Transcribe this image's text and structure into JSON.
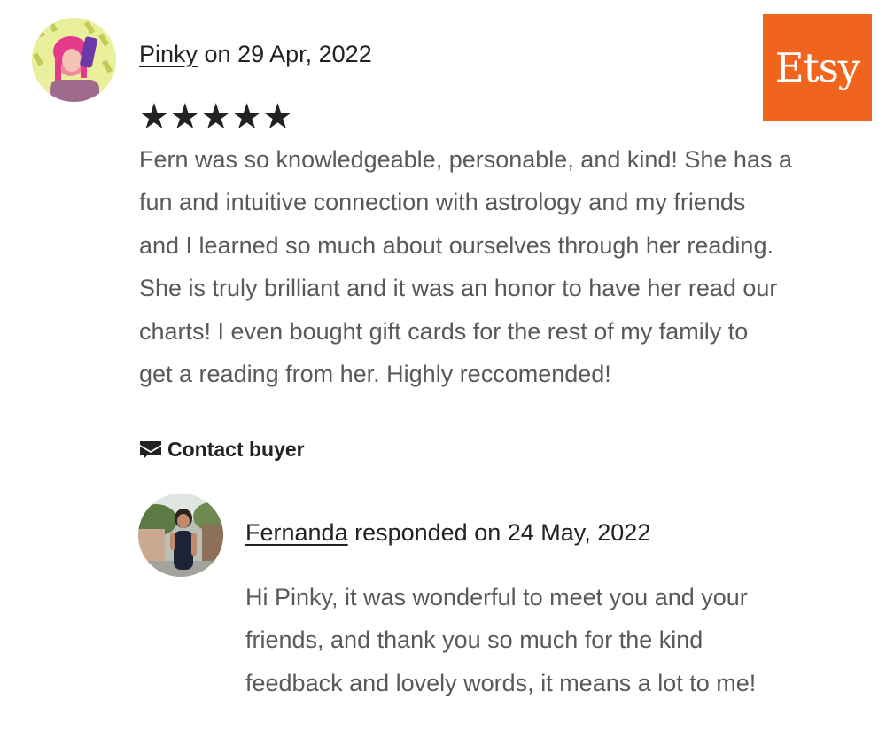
{
  "review": {
    "reviewer_name": "Pinky",
    "date_text": " on 29 Apr, 2022",
    "stars": "★★★★★",
    "rating": 5,
    "text_lines": [
      "Fern was so knowledgeable, personable, and kind! She has a",
      "fun and intuitive connection with astrology and my friends",
      "and I learned so much about ourselves through her reading.",
      "She is truly brilliant and it was an honor to have her read our",
      "charts! I even bought gift cards for the rest of my family to",
      "get a reading from her. Highly reccomended!"
    ],
    "contact_label": "Contact buyer"
  },
  "reply": {
    "seller_name": "Fernanda",
    "date_text": " responded on 24 May, 2022",
    "text_lines": [
      "Hi Pinky, it was wonderful to meet you and your",
      "friends, and thank you so much for the kind",
      "feedback and lovely words, it means a lot to me!"
    ]
  },
  "brand": {
    "logo_text": "Etsy",
    "color": "#F1641E"
  },
  "icons": {
    "contact": "envelope-message-icon"
  }
}
